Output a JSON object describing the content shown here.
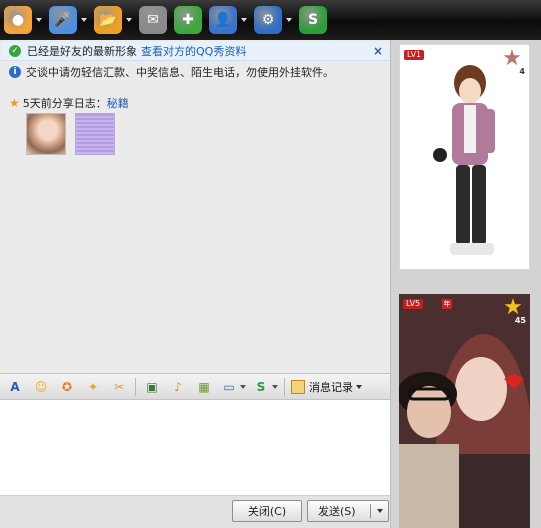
{
  "toolbar": {
    "buttons": [
      {
        "name": "webcam-icon",
        "color": "#f4a43a",
        "glyph": "●",
        "has_arrow": true
      },
      {
        "name": "microphone-icon",
        "color": "#4c8fe0",
        "glyph": "🎤",
        "has_arrow": true
      },
      {
        "name": "send-file-icon",
        "color": "#f0a020",
        "glyph": "📂",
        "has_arrow": true
      },
      {
        "name": "email-icon",
        "color": "#8a8a8a",
        "glyph": "✉",
        "has_arrow": false
      },
      {
        "name": "create-group-icon",
        "color": "#3aa83a",
        "glyph": "✚",
        "has_arrow": false
      },
      {
        "name": "chat-member-icon",
        "color": "#3a73c8",
        "glyph": "👤",
        "has_arrow": true
      },
      {
        "name": "settings-icon",
        "color": "#2f6ec4",
        "glyph": "⚙",
        "has_arrow": true
      },
      {
        "name": "soso-icon",
        "color": "#2d9e3a",
        "glyph": "S",
        "has_arrow": false
      }
    ]
  },
  "notice": {
    "text": "已经是好友的最新形象",
    "link": "查看对方的QQ秀资料",
    "close": "×"
  },
  "warning": {
    "icon": "i",
    "text": "交谈中请勿轻信汇款、中奖信息、陌生电话，勿使用外挂软件。"
  },
  "share": {
    "prefix": "5天前分享日志：",
    "link": "秘籍"
  },
  "input_toolbar": {
    "items": [
      {
        "name": "font-icon",
        "glyph": "A",
        "color": "#2a5ea8",
        "arrow": false
      },
      {
        "name": "emoticon-icon",
        "glyph": "☺",
        "color": "#f0b000",
        "arrow": false
      },
      {
        "name": "magic-emoticon-icon",
        "glyph": "✪",
        "color": "#e07a2a",
        "arrow": false
      },
      {
        "name": "shake-window-icon",
        "glyph": "✦",
        "color": "#f0a020",
        "arrow": false
      },
      {
        "name": "screen-capture-icon",
        "glyph": "✂",
        "color": "#e0a030",
        "arrow": false
      },
      {
        "name": "image-icon",
        "glyph": "▣",
        "color": "#3a7a3a",
        "arrow": false
      },
      {
        "name": "music-icon",
        "glyph": "♪",
        "color": "#d89a1a",
        "arrow": false
      },
      {
        "name": "gift-icon",
        "glyph": "▦",
        "color": "#6a9a2a",
        "arrow": false
      },
      {
        "name": "screenshot-icon",
        "glyph": "▭",
        "color": "#3a6ac0",
        "arrow": true
      },
      {
        "name": "soso-search-icon",
        "glyph": "S",
        "color": "#2d9e3a",
        "arrow": true
      }
    ],
    "history_label": "消息记录"
  },
  "buttons": {
    "close": "关闭(C)",
    "send": "发送(S)"
  },
  "show1": {
    "level": "LV1",
    "star_count": "4"
  },
  "show2": {
    "level": "LV5",
    "vip": "年",
    "star_count": "45"
  }
}
